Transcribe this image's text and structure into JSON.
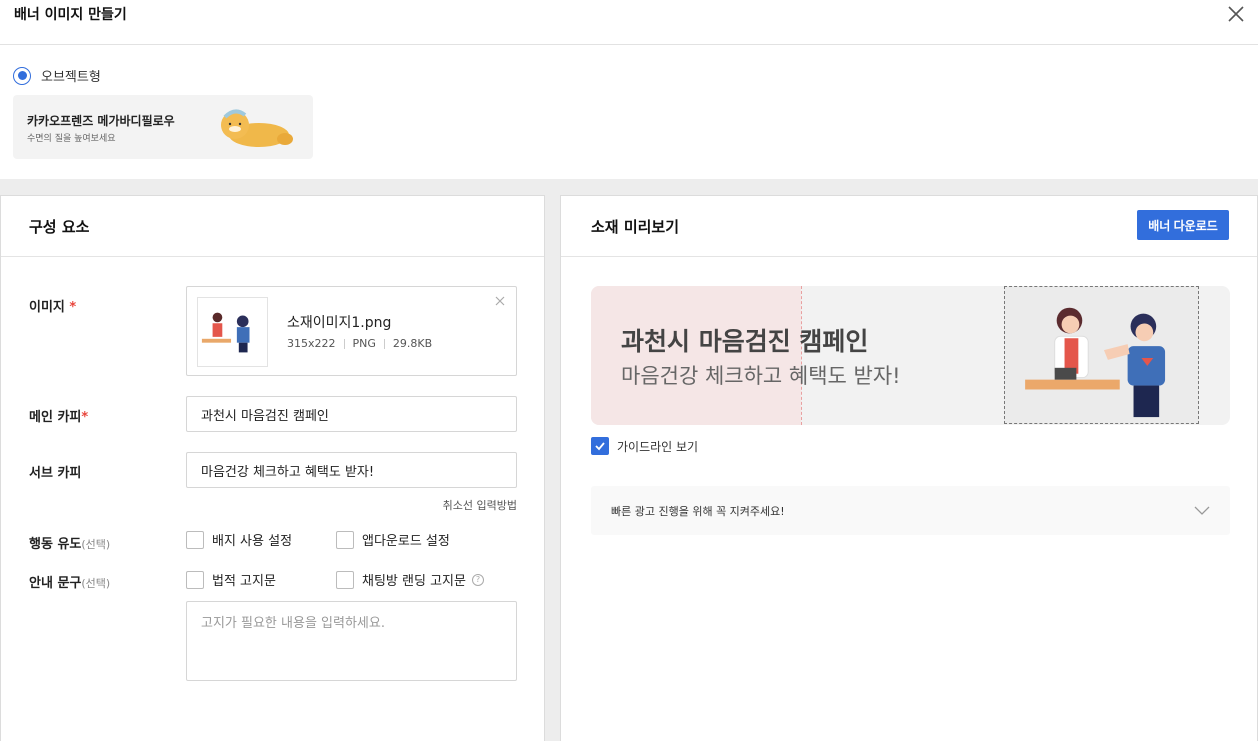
{
  "header": {
    "title": "배너 이미지 만들기"
  },
  "type_selector": {
    "option_label": "오브젝트형",
    "card": {
      "title": "카카오프렌즈 메가바디필로우",
      "subtitle": "수면의 질을 높여보세요"
    }
  },
  "components": {
    "title": "구성 요소",
    "image": {
      "label": "이미지",
      "required_mark": "*",
      "file_name": "소재이미지1.png",
      "dimensions": "315x222",
      "format": "PNG",
      "size": "29.8KB"
    },
    "main_copy": {
      "label": "메인 카피",
      "required_mark": "*",
      "value": "과천시 마음검진 캠페인"
    },
    "sub_copy": {
      "label": "서브 카피",
      "value": "마음건강 체크하고 혜택도 받자!"
    },
    "input_method_link": "취소선 입력방법",
    "cta": {
      "label": "행동 유도",
      "optional": "(선택)",
      "options": [
        "배지 사용 설정",
        "앱다운로드 설정"
      ]
    },
    "notice": {
      "label": "안내 문구",
      "optional": "(선택)",
      "options": [
        "법적 고지문",
        "채팅방 랜딩 고지문"
      ],
      "help_symbol": "?",
      "placeholder": "고지가 필요한 내용을 입력하세요."
    }
  },
  "preview": {
    "title": "소재 미리보기",
    "download_button": "배너 다운로드",
    "banner": {
      "main_copy": "과천시 마음검진 캠페인",
      "sub_copy": "마음건강 체크하고 혜택도 받자!"
    },
    "guideline_toggle": "가이드라인 보기",
    "accordion_text": "빠른 광고 진행을 위해 꼭 지켜주세요!"
  },
  "colors": {
    "accent": "#326edc",
    "required": "#e8453c",
    "banner_pink": "#f5e6e6",
    "banner_bg": "#f2f2f2"
  }
}
